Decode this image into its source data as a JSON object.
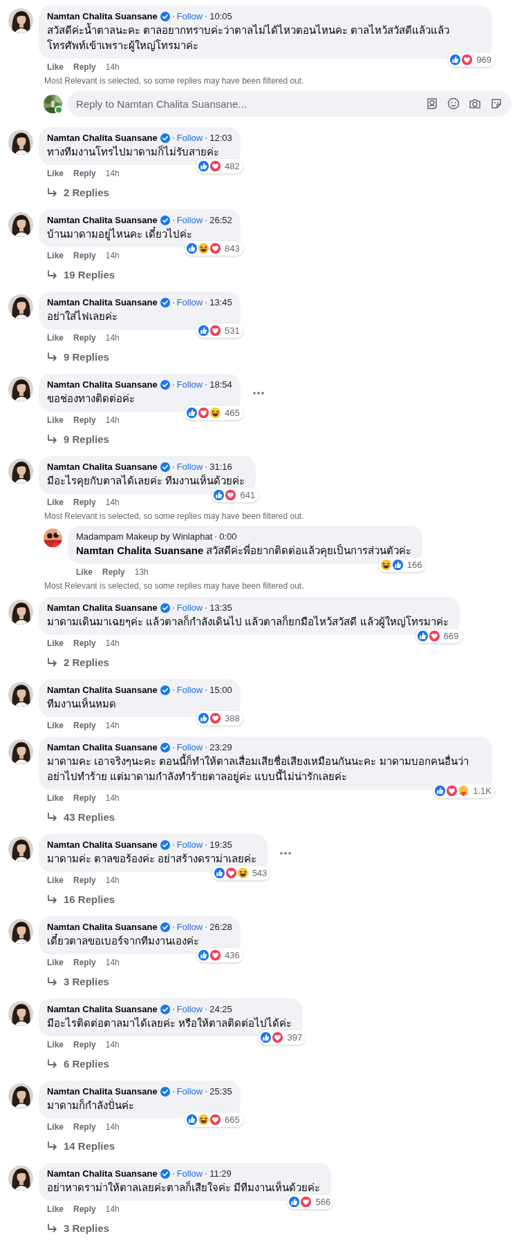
{
  "thread": [
    {
      "kind": "comment",
      "author": "Namtan Chalita Suansane",
      "verified": true,
      "follow": "Follow",
      "time": "10:05",
      "text": "สวัสดีค่ะน้ำตาลนะคะ ตาลอยากทราบค่ะว่าตาลไม่ได้ไหวตอนไหนคะ ตาลไหว้สวัสดีแล้วแล้วโทรศัพท์เข้าเพราะผู้ใหญ่โทรมาค่ะ",
      "reactions": [
        {
          "kind": "like"
        },
        {
          "kind": "love"
        }
      ],
      "reaction_count": "969",
      "actions": [
        "Like",
        "Reply"
      ],
      "age": "14h",
      "more_menu": false
    },
    {
      "kind": "notice",
      "text": "Most Relevant is selected, so some replies may have been filtered out."
    },
    {
      "kind": "reply_box",
      "placeholder": "Reply to Namtan Chalita Suansane...",
      "online": true
    },
    {
      "kind": "comment",
      "author": "Namtan Chalita Suansane",
      "verified": true,
      "follow": "Follow",
      "time": "12:03",
      "text": "ทางทีมงานโทรไปมาดามก็ไม่รับสายค่ะ",
      "reactions": [
        {
          "kind": "like"
        },
        {
          "kind": "love"
        }
      ],
      "reaction_count": "482",
      "actions": [
        "Like",
        "Reply"
      ],
      "age": "14h",
      "more_menu": false,
      "replies": "2 Replies"
    },
    {
      "kind": "comment",
      "author": "Namtan Chalita Suansane",
      "verified": true,
      "follow": "Follow",
      "time": "26:52",
      "text": "บ้านมาดามอยู่ไหนคะ เดี๋ยวไปค่ะ",
      "reactions": [
        {
          "kind": "like"
        },
        {
          "kind": "haha"
        },
        {
          "kind": "love"
        }
      ],
      "reaction_count": "843",
      "actions": [
        "Like",
        "Reply"
      ],
      "age": "14h",
      "more_menu": false,
      "replies": "19 Replies"
    },
    {
      "kind": "comment",
      "author": "Namtan Chalita Suansane",
      "verified": true,
      "follow": "Follow",
      "time": "13:45",
      "text": "อย่าใส่ไฟเลยค่ะ",
      "reactions": [
        {
          "kind": "like"
        },
        {
          "kind": "love"
        }
      ],
      "reaction_count": "531",
      "actions": [
        "Like",
        "Reply"
      ],
      "age": "14h",
      "more_menu": false,
      "replies": "9 Replies"
    },
    {
      "kind": "comment",
      "author": "Namtan Chalita Suansane",
      "verified": true,
      "follow": "Follow",
      "time": "18:54",
      "text": "ขอช่องทางติดต่อค่ะ",
      "reactions": [
        {
          "kind": "like"
        },
        {
          "kind": "love"
        },
        {
          "kind": "haha"
        }
      ],
      "reaction_count": "465",
      "actions": [
        "Like",
        "Reply"
      ],
      "age": "14h",
      "more_menu": true,
      "replies": "9 Replies"
    },
    {
      "kind": "comment",
      "author": "Namtan Chalita Suansane",
      "verified": true,
      "follow": "Follow",
      "time": "31:16",
      "text": "มีอะไรคุยกับตาลได้เลยค่ะ ทีมงานเห็นด้วยค่ะ",
      "reactions": [
        {
          "kind": "like"
        },
        {
          "kind": "love"
        }
      ],
      "reaction_count": "641",
      "actions": [
        "Like",
        "Reply"
      ],
      "age": "14h",
      "more_menu": false
    },
    {
      "kind": "notice",
      "text": "Most Relevant is selected, so some replies may have been filtered out."
    },
    {
      "kind": "reply",
      "author": "Madampam Makeup by Winlaphat",
      "verified": false,
      "time": "0:00",
      "text": "**Namtan Chalita Suansane** สวัสดีค่ะพี่อยากติดต่อแล้วคุยเป็นการส่วนตัวค่ะ",
      "reactions": [
        {
          "kind": "haha"
        },
        {
          "kind": "like"
        }
      ],
      "reaction_count": "166",
      "actions": [
        "Like",
        "Reply"
      ],
      "age": "13h",
      "more_menu": false
    },
    {
      "kind": "notice",
      "text": "Most Relevant is selected, so some replies may have been filtered out."
    },
    {
      "kind": "comment",
      "author": "Namtan Chalita Suansane",
      "verified": true,
      "follow": "Follow",
      "time": "13:35",
      "text": "มาดามเดินมาเฉยๆค่ะ แล้วตาลก็กำลังเดินไป แล้วตาลก็ยกมือไหว้สวัสดี แล้วผู้ใหญ่โทรมาค่ะ",
      "reactions": [
        {
          "kind": "like"
        },
        {
          "kind": "love"
        }
      ],
      "reaction_count": "669",
      "actions": [
        "Like",
        "Reply"
      ],
      "age": "14h",
      "more_menu": false,
      "replies": "2 Replies"
    },
    {
      "kind": "comment",
      "author": "Namtan Chalita Suansane",
      "verified": true,
      "follow": "Follow",
      "time": "15:00",
      "text": "ทีมงานเห็นหมด",
      "reactions": [
        {
          "kind": "like"
        },
        {
          "kind": "love"
        }
      ],
      "reaction_count": "388",
      "actions": [
        "Like",
        "Reply"
      ],
      "age": "14h",
      "more_menu": false
    },
    {
      "kind": "comment",
      "author": "Namtan Chalita Suansane",
      "verified": true,
      "follow": "Follow",
      "time": "23:29",
      "text": "มาดามคะ เอาจริงๆนะคะ ตอนนี้ก็ทำให้ตาลเสื่อมเสียชื่อเสียงเหมือนกันนะคะ มาดามบอกคนอื่นว่าอย่าไปทำร้าย แต่มาดามกำลังทำร้ายตาลอยู่ค่ะ แบบนี้ไม่น่ารักเลยค่ะ",
      "reactions": [
        {
          "kind": "like"
        },
        {
          "kind": "love"
        },
        {
          "kind": "care"
        }
      ],
      "reaction_count": "1.1K",
      "actions": [
        "Like",
        "Reply"
      ],
      "age": "14h",
      "more_menu": false,
      "replies": "43 Replies"
    },
    {
      "kind": "comment",
      "author": "Namtan Chalita Suansane",
      "verified": true,
      "follow": "Follow",
      "time": "19:35",
      "text": "มาดามค่ะ ตาลขอร้องค่ะ อย่าสร้างดราม่าเลยค่ะ",
      "reactions": [
        {
          "kind": "like"
        },
        {
          "kind": "love"
        },
        {
          "kind": "haha"
        }
      ],
      "reaction_count": "543",
      "actions": [
        "Like",
        "Reply"
      ],
      "age": "14h",
      "more_menu": true,
      "replies": "16 Replies"
    },
    {
      "kind": "comment",
      "author": "Namtan Chalita Suansane",
      "verified": true,
      "follow": "Follow",
      "time": "26:28",
      "text": "เดี๋ยวตาลขอเบอร์จากทีมงานเองค่ะ",
      "reactions": [
        {
          "kind": "like"
        },
        {
          "kind": "love"
        }
      ],
      "reaction_count": "436",
      "actions": [
        "Like",
        "Reply"
      ],
      "age": "14h",
      "more_menu": false,
      "replies": "3 Replies"
    },
    {
      "kind": "comment",
      "author": "Namtan Chalita Suansane",
      "verified": true,
      "follow": "Follow",
      "time": "24:25",
      "text": "มีอะไรติดต่อตาลมาได้เลยค่ะ หรือให้ตาลติดต่อไปได้ค่ะ",
      "reactions": [
        {
          "kind": "like"
        },
        {
          "kind": "love"
        }
      ],
      "reaction_count": "397",
      "actions": [
        "Like",
        "Reply"
      ],
      "age": "14h",
      "more_menu": false,
      "replies": "6 Replies"
    },
    {
      "kind": "comment",
      "author": "Namtan Chalita Suansane",
      "verified": true,
      "follow": "Follow",
      "time": "25:35",
      "text": "มาดามก็กำลังปั่นค่ะ",
      "reactions": [
        {
          "kind": "like"
        },
        {
          "kind": "haha"
        },
        {
          "kind": "love"
        }
      ],
      "reaction_count": "665",
      "actions": [
        "Like",
        "Reply"
      ],
      "age": "14h",
      "more_menu": false,
      "replies": "14 Replies"
    },
    {
      "kind": "comment",
      "author": "Namtan Chalita Suansane",
      "verified": true,
      "follow": "Follow",
      "time": "11:29",
      "text": "อย่าหาดราม่าให้ตาลเลยค่ะตาลก็เสียใจค่ะ มีทีมงานเห็นด้วยค่ะ",
      "reactions": [
        {
          "kind": "like"
        },
        {
          "kind": "love"
        }
      ],
      "reaction_count": "566",
      "actions": [
        "Like",
        "Reply"
      ],
      "age": "14h",
      "more_menu": false,
      "replies": "3 Replies"
    }
  ]
}
